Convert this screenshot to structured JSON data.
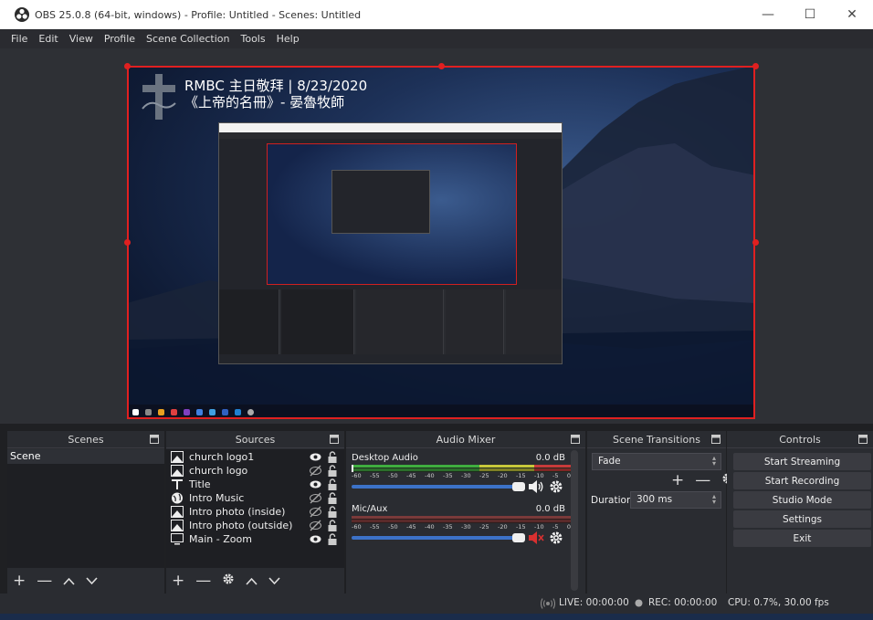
{
  "window": {
    "title": "OBS 25.0.8 (64-bit, windows) - Profile: Untitled - Scenes: Untitled",
    "minimize_glyph": "—",
    "maximize_glyph": "☐",
    "close_glyph": "✕"
  },
  "menu": [
    "File",
    "Edit",
    "View",
    "Profile",
    "Scene Collection",
    "Tools",
    "Help"
  ],
  "preview": {
    "overlay_line1": "RMBC 主日敬拜 | 8/23/2020",
    "overlay_line2": "《上帝的名冊》- 晏魯牧師"
  },
  "docks": {
    "scenes": {
      "header": "Scenes",
      "items": [
        "Scene"
      ]
    },
    "sources": {
      "header": "Sources",
      "items": [
        {
          "name": "church logo1",
          "icon": "image-icon",
          "visible": true
        },
        {
          "name": "church logo",
          "icon": "image-icon",
          "visible": false
        },
        {
          "name": "Title",
          "icon": "text-icon",
          "visible": true
        },
        {
          "name": "Intro Music",
          "icon": "globe-icon",
          "visible": false
        },
        {
          "name": "Intro photo (inside)",
          "icon": "image-icon",
          "visible": false
        },
        {
          "name": "Intro photo (outside)",
          "icon": "image-icon",
          "visible": false
        },
        {
          "name": "Main - Zoom",
          "icon": "monitor-icon",
          "visible": true
        }
      ]
    },
    "mixer": {
      "header": "Audio Mixer",
      "ticks": [
        "-60",
        "-55",
        "-50",
        "-45",
        "-40",
        "-35",
        "-30",
        "-25",
        "-20",
        "-15",
        "-10",
        "-5",
        "0"
      ],
      "channels": [
        {
          "name": "Desktop Audio",
          "db": "0.0 dB",
          "muted": false
        },
        {
          "name": "Mic/Aux",
          "db": "0.0 dB",
          "muted": true
        }
      ]
    },
    "transitions": {
      "header": "Scene Transitions",
      "selected": "Fade",
      "duration_label": "Duration",
      "duration_value": "300 ms"
    },
    "controls": {
      "header": "Controls",
      "buttons": [
        "Start Streaming",
        "Start Recording",
        "Studio Mode",
        "Settings",
        "Exit"
      ]
    }
  },
  "status": {
    "live": "LIVE: 00:00:00",
    "rec": "REC: 00:00:00",
    "cpu": "CPU: 0.7%, 30.00 fps"
  },
  "colors": {
    "selection": "#e02020",
    "meter_green": "#3fae3f",
    "meter_yellow": "#c8c83a",
    "meter_red": "#c83a3a",
    "volume_blue": "#3c72c8"
  }
}
